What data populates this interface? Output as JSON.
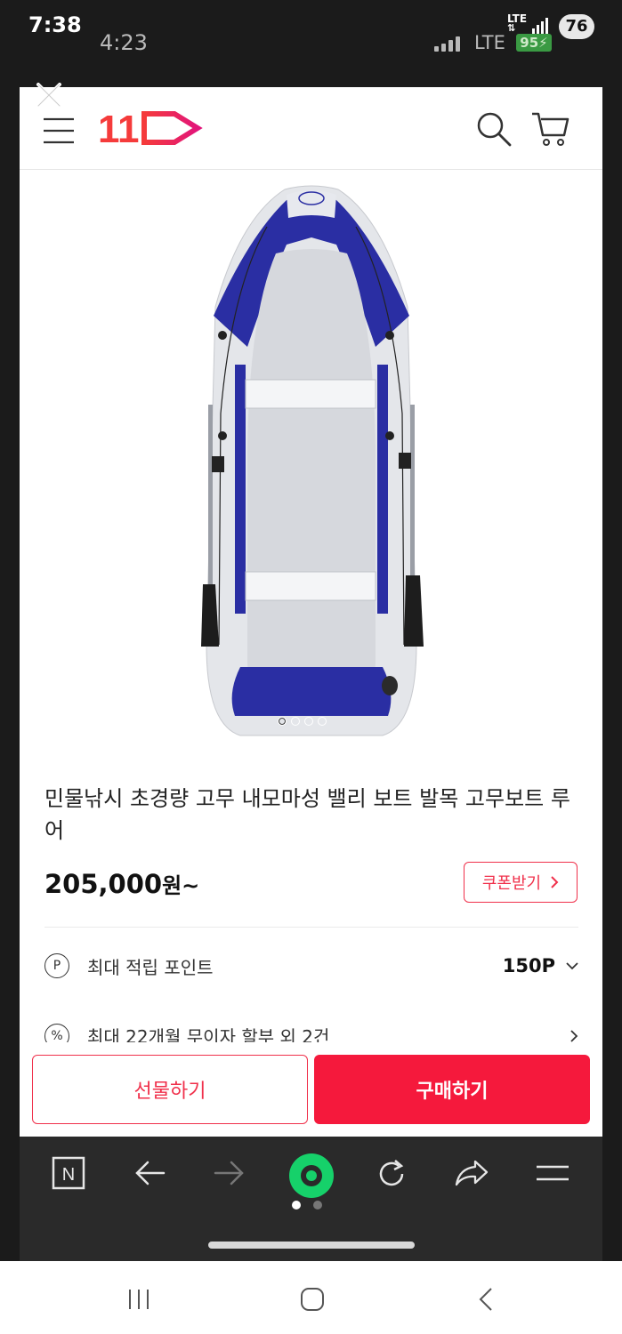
{
  "status_outer": {
    "time": "7:38",
    "network": "LTE",
    "battery": "76"
  },
  "status_inner": {
    "time": "4:23",
    "network": "LTE",
    "battery": "95"
  },
  "header": {
    "logo_text": "11"
  },
  "product": {
    "title": "민물낚시 초경량 고무 내모마성 밸리 보트 발목 고무보트 루어",
    "price": "205,000",
    "price_unit": "원~",
    "coupon_label": "쿠폰받기",
    "image_count": 4,
    "image_index": 1
  },
  "points": {
    "icon_text": "P",
    "label": "최대 적립 포인트",
    "value": "150P"
  },
  "installment": {
    "icon_text": "%",
    "label": "최대 22개월 무이자 할부 외 2건"
  },
  "actions": {
    "gift_label": "선물하기",
    "buy_label": "구매하기"
  },
  "browser": {
    "n_label": "N",
    "pages": 2,
    "active_page": 1
  },
  "colors": {
    "brand": "#f5193c",
    "nav_bg": "#2a2a2a",
    "boat_blue": "#2a2ea3",
    "boat_grey": "#e4e6ea"
  }
}
